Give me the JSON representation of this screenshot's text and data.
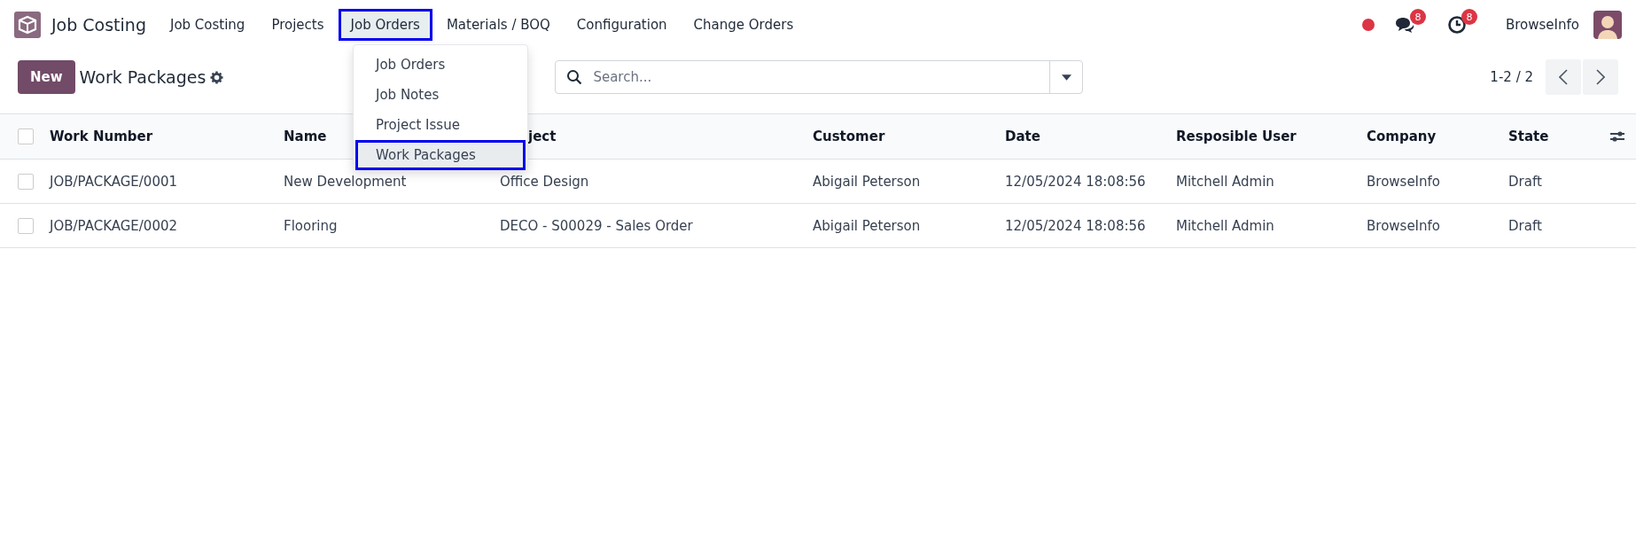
{
  "app": {
    "title": "Job Costing"
  },
  "menu": [
    {
      "label": "Job Costing",
      "selected": false
    },
    {
      "label": "Projects",
      "selected": false
    },
    {
      "label": "Job Orders",
      "selected": true
    },
    {
      "label": "Materials / BOQ",
      "selected": false
    },
    {
      "label": "Configuration",
      "selected": false
    },
    {
      "label": "Change Orders",
      "selected": false
    }
  ],
  "dropdown": [
    {
      "label": "Job Orders",
      "selected": false
    },
    {
      "label": "Job Notes",
      "selected": false
    },
    {
      "label": "Project Issue",
      "selected": false
    },
    {
      "label": "Work Packages",
      "selected": true
    }
  ],
  "systray": {
    "messages_count": "8",
    "activities_count": "8",
    "user": "BrowseInfo"
  },
  "control_panel": {
    "new_button": "New",
    "title": "Work Packages",
    "search": {
      "placeholder": "Search..."
    },
    "pager": "1-2 / 2"
  },
  "table": {
    "all_selected": false,
    "columns": [
      "Work Number",
      "Name",
      "ject",
      "Customer",
      "Date",
      "Resposible User",
      "Company",
      "State"
    ],
    "rows": [
      {
        "selected": false,
        "cells": [
          "JOB/PACKAGE/0001",
          "New Development",
          "Office Design",
          "Abigail Peterson",
          "12/05/2024 18:08:56",
          "Mitchell Admin",
          "BrowseInfo",
          "Draft"
        ]
      },
      {
        "selected": false,
        "cells": [
          "JOB/PACKAGE/0002",
          "Flooring",
          "DECO - S00029 - Sales Order",
          "Abigail Peterson",
          "12/05/2024 18:08:56",
          "Mitchell Admin",
          "BrowseInfo",
          "Draft"
        ]
      }
    ]
  }
}
